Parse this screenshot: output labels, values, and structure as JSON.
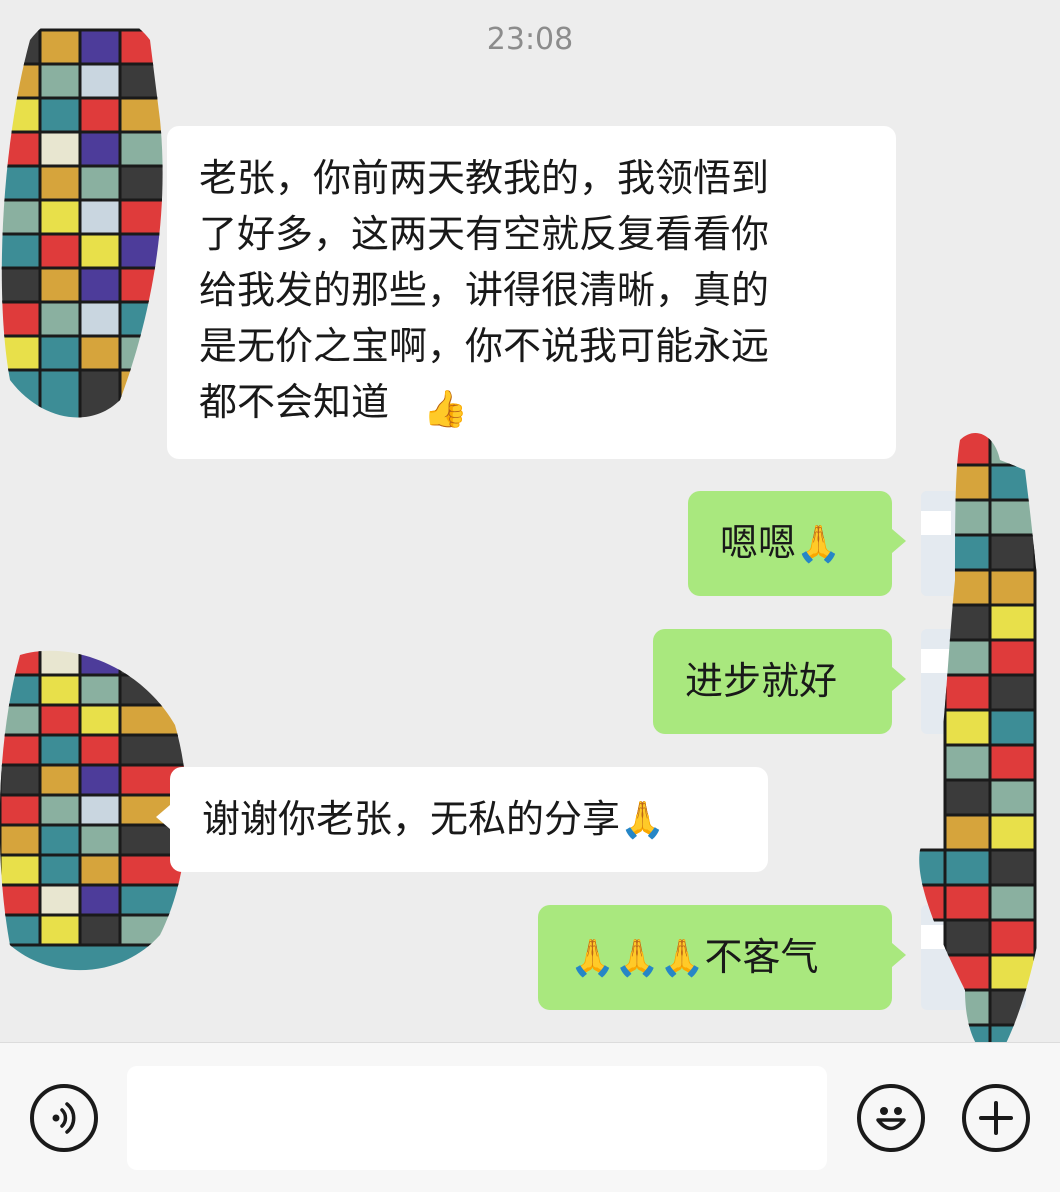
{
  "header": {
    "timestamp": "23:08"
  },
  "messages": [
    {
      "direction": "incoming",
      "text": "老张，你前两天教我的，我领悟到\n了好多，这两天有空就反复看看你\n给我发的那些，讲得很清晰，真的\n是无价之宝啊，你不说我可能永远\n都不会知道",
      "emoji": "👍",
      "emoji_icon": "thumbs-up-icon"
    },
    {
      "direction": "outgoing",
      "text": "嗯嗯",
      "emoji": "🙏",
      "emoji_icon": "praying-hands-icon"
    },
    {
      "direction": "outgoing",
      "text": "进步就好"
    },
    {
      "direction": "incoming",
      "text": "谢谢你老张，无私的分享",
      "emoji": "🙏",
      "emoji_icon": "praying-hands-icon"
    },
    {
      "direction": "outgoing",
      "prefix_emoji": "🙏🙏🙏",
      "emoji_icon": "praying-hands-icon",
      "text": "不客气"
    }
  ],
  "toolbar": {
    "voice_icon": "voice-icon",
    "emoji_icon": "smiley-icon",
    "more_icon": "plus-icon",
    "input_value": ""
  },
  "colors": {
    "background": "#ededed",
    "incoming_bubble": "#ffffff",
    "outgoing_bubble": "#a9e87e",
    "timestamp": "#8c8c8c"
  }
}
